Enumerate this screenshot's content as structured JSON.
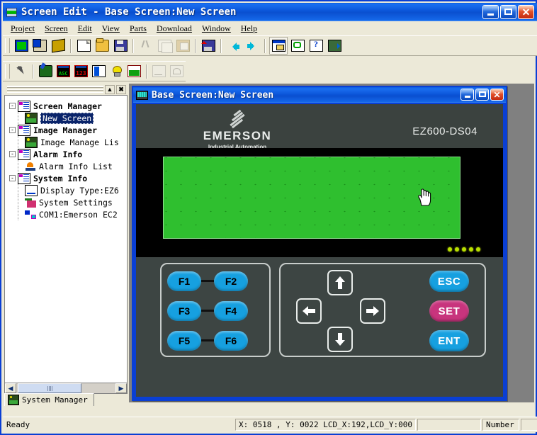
{
  "window": {
    "title": "Screen Edit - Base Screen:New Screen",
    "icon": "app-window-icon",
    "buttons": {
      "minimize": "Minimize",
      "maximize": "Maximize",
      "close": "Close"
    }
  },
  "menubar": {
    "items": [
      {
        "label": "Project"
      },
      {
        "label": "Screen"
      },
      {
        "label": "Edit"
      },
      {
        "label": "View"
      },
      {
        "label": "Parts"
      },
      {
        "label": "Download"
      },
      {
        "label": "Window"
      },
      {
        "label": "Help"
      }
    ]
  },
  "toolbar_main": {
    "items": [
      {
        "name": "new-screen-icon",
        "tip": "New Screen"
      },
      {
        "name": "copy-screen-icon",
        "tip": "Copy Screen"
      },
      {
        "name": "screen-stack-icon",
        "tip": "Screen Stack"
      },
      {
        "name": "new-file-icon",
        "tip": "New"
      },
      {
        "name": "open-file-icon",
        "tip": "Open"
      },
      {
        "name": "save-icon",
        "tip": "Save"
      },
      {
        "name": "cut-icon",
        "tip": "Cut"
      },
      {
        "name": "copy-icon",
        "tip": "Copy"
      },
      {
        "name": "paste-icon",
        "tip": "Paste"
      },
      {
        "name": "save-all-icon",
        "tip": "Save All"
      },
      {
        "name": "back-arrow-icon",
        "tip": "Previous Screen"
      },
      {
        "name": "forward-arrow-icon",
        "tip": "Next Screen"
      },
      {
        "name": "window-list-icon",
        "tip": "Window List"
      },
      {
        "name": "refresh-icon",
        "tip": "Refresh"
      },
      {
        "name": "help-icon",
        "tip": "Help"
      },
      {
        "name": "exit-icon",
        "tip": "Exit"
      }
    ]
  },
  "toolbar_parts": {
    "items": [
      {
        "name": "select-pointer-icon",
        "tip": "Select"
      },
      {
        "name": "lamp-icon",
        "tip": "Lamp"
      },
      {
        "name": "ascii-display-icon",
        "tip": "ASCII Display"
      },
      {
        "name": "numeric-display-icon",
        "tip": "Numeric Display"
      },
      {
        "name": "bar-graph-icon",
        "tip": "Bar Graph"
      },
      {
        "name": "indicator-lamp-icon",
        "tip": "Indicator"
      },
      {
        "name": "picture-icon",
        "tip": "Picture"
      },
      {
        "name": "trend-graph-icon",
        "tip": "Trend Graph"
      },
      {
        "name": "meter-icon",
        "tip": "Meter"
      }
    ]
  },
  "project_panel": {
    "pin_label": "▲",
    "close_label": "✖",
    "tree": [
      {
        "label": "Screen Manager",
        "icon": "folder-screen-icon",
        "level": 0,
        "bold": true,
        "expander": "-"
      },
      {
        "label": "New Screen",
        "icon": "screen-item-icon",
        "level": 1,
        "bold": false,
        "selected": true
      },
      {
        "label": "Image Manager",
        "icon": "folder-image-icon",
        "level": 0,
        "bold": true,
        "expander": "-"
      },
      {
        "label": "Image Manage Lis",
        "icon": "image-item-icon",
        "level": 1,
        "bold": false
      },
      {
        "label": "Alarm Info",
        "icon": "folder-alarm-icon",
        "level": 0,
        "bold": true,
        "expander": "-"
      },
      {
        "label": "Alarm Info List",
        "icon": "alarm-item-icon",
        "level": 1,
        "bold": false
      },
      {
        "label": "System Info",
        "icon": "folder-system-icon",
        "level": 0,
        "bold": true,
        "expander": "-"
      },
      {
        "label": "Display Type:EZ6",
        "icon": "display-type-icon",
        "level": 1,
        "bold": false
      },
      {
        "label": "System Settings",
        "icon": "system-settings-icon",
        "level": 1,
        "bold": false
      },
      {
        "label": "COM1:Emerson EC2",
        "icon": "com-port-icon",
        "level": 1,
        "bold": false
      }
    ],
    "tab": {
      "label": "System Manager",
      "icon": "system-manager-icon"
    }
  },
  "child_window": {
    "title": "Base Screen:New Screen",
    "icon": "base-screen-icon",
    "buttons": {
      "minimize": "Minimize",
      "maximize": "Maximize",
      "close": "Close"
    }
  },
  "device": {
    "brand": "EMERSON",
    "brand_sub": "Industrial Automation",
    "model": "EZ600-DS04",
    "lcd": {
      "background_color": "#2fbf2f",
      "dot_color": "#1b8f1b"
    },
    "led_count": 5,
    "led_color": "#b8e000",
    "function_keys": [
      "F1",
      "F2",
      "F3",
      "F4",
      "F5",
      "F6"
    ],
    "function_key_color": "#16a0e0",
    "nav_keys": [
      {
        "name": "arrow-up-icon",
        "label": "Up"
      },
      {
        "name": "arrow-left-icon",
        "label": "Left"
      },
      {
        "name": "arrow-right-icon",
        "label": "Right"
      },
      {
        "name": "arrow-down-icon",
        "label": "Down"
      }
    ],
    "right_keys": [
      {
        "label": "ESC",
        "color": "#16a0e0"
      },
      {
        "label": "SET",
        "color": "#c8347d"
      },
      {
        "label": "ENT",
        "color": "#16a0e0"
      }
    ]
  },
  "statusbar": {
    "message": "Ready",
    "coordinates": "X: 0518 , Y: 0022  LCD_X:192,LCD_Y:000",
    "blank1": "",
    "mode": "Number",
    "blank2": ""
  }
}
